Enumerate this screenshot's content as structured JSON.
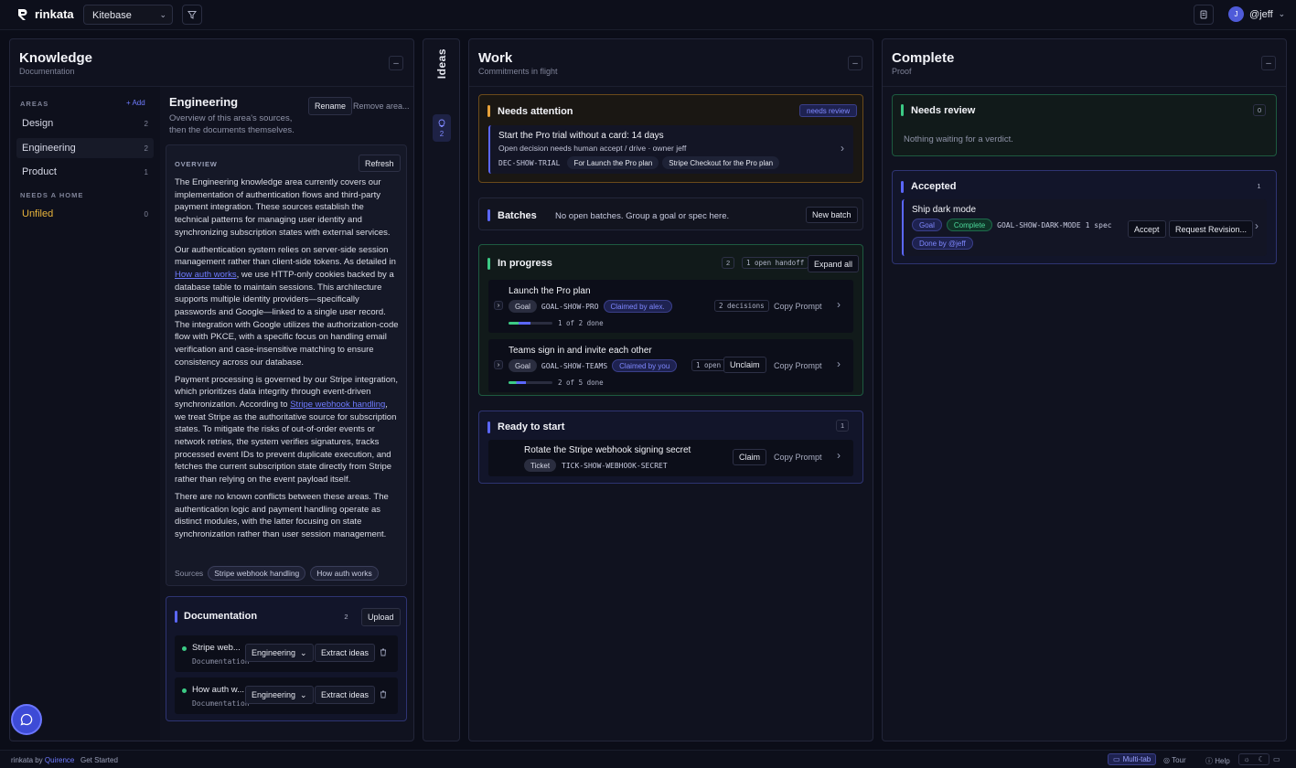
{
  "app": {
    "name": "rinkata",
    "workspace": "Kitebase",
    "user": "@jeff",
    "user_initial": "J"
  },
  "knowledge": {
    "title": "Knowledge",
    "subtitle": "Documentation",
    "areas_label": "AREAS",
    "add_label": "+ Add",
    "areas": [
      {
        "label": "Design",
        "count": "2"
      },
      {
        "label": "Engineering",
        "count": "2"
      },
      {
        "label": "Product",
        "count": "1"
      }
    ],
    "needs_home_label": "NEEDS A HOME",
    "unfiled": {
      "label": "Unfiled",
      "count": "0"
    },
    "detail": {
      "title": "Engineering",
      "subtitle": "Overview of this area's sources, then the documents themselves.",
      "rename_label": "Rename",
      "remove_label": "Remove area...",
      "overview_label": "OVERVIEW",
      "refresh_label": "Refresh",
      "p1": "The Engineering knowledge area currently covers our implementation of authentication flows and third-party payment integration. These sources establish the technical patterns for managing user identity and synchronizing subscription states with external services.",
      "p2a": "Our authentication system relies on server-side session management rather than client-side tokens. As detailed in ",
      "p2link": "How auth works",
      "p2b": ", we use HTTP-only cookies backed by a database table to maintain sessions. This architecture supports multiple identity providers—specifically passwords and Google—linked to a single user record. The integration with Google utilizes the authorization-code flow with PKCE, with a specific focus on handling email verification and case-insensitive matching to ensure consistency across our database.",
      "p3a": "Payment processing is governed by our Stripe integration, which prioritizes data integrity through event-driven synchronization. According to ",
      "p3link": "Stripe webhook handling",
      "p3b": ", we treat Stripe as the authoritative source for subscription states. To mitigate the risks of out-of-order events or network retries, the system verifies signatures, tracks processed event IDs to prevent duplicate execution, and fetches the current subscription state directly from Stripe rather than relying on the event payload itself.",
      "p4": "There are no known conflicts between these areas. The authentication logic and payment handling operate as distinct modules, with the latter focusing on state synchronization rather than user session management.",
      "sources_label": "Sources",
      "sources": [
        "Stripe webhook handling",
        "How auth works"
      ]
    },
    "documentation": {
      "title": "Documentation",
      "count": "2",
      "upload_label": "Upload",
      "docs": [
        {
          "name": "Stripe web...",
          "type": "Documentation",
          "area": "Engineering",
          "action": "Extract ideas"
        },
        {
          "name": "How auth w...",
          "type": "Documentation",
          "area": "Engineering",
          "action": "Extract ideas"
        }
      ]
    }
  },
  "ideas": {
    "label": "Ideas",
    "count": "2"
  },
  "work": {
    "title": "Work",
    "subtitle": "Commitments in flight",
    "attention": {
      "title": "Needs attention",
      "badge": "needs review",
      "item": {
        "title": "Start the Pro trial without a card: 14 days",
        "desc": "Open decision needs human accept / drive · owner jeff",
        "code": "DEC-SHOW-TRIAL",
        "tags": [
          "For Launch the Pro plan",
          "Stripe Checkout for the Pro plan"
        ]
      }
    },
    "batches": {
      "title": "Batches",
      "text": "No open batches. Group a goal or spec here.",
      "button": "New batch"
    },
    "in_progress": {
      "title": "In progress",
      "count": "2",
      "handoff": "1 open handoff",
      "expand_label": "Expand all",
      "items": [
        {
          "title": "Launch the Pro plan",
          "type": "Goal",
          "code": "GOAL-SHOW-PRO",
          "claim": "Claimed by alex.",
          "meta": "2 decisions",
          "progress_text": "1 of 2 done",
          "progress": 0.5,
          "prompt": "Copy Prompt"
        },
        {
          "title": "Teams sign in and invite each other",
          "type": "Goal",
          "code": "GOAL-SHOW-TEAMS",
          "claim": "Claimed by you",
          "meta": "1 open",
          "action": "Unclaim",
          "progress_text": "2 of 5 done",
          "progress": 0.4,
          "prompt": "Copy Prompt"
        }
      ]
    },
    "ready": {
      "title": "Ready to start",
      "count": "1",
      "item": {
        "title": "Rotate the Stripe webhook signing secret",
        "type": "Ticket",
        "code": "TICK-SHOW-WEBHOOK-SECRET",
        "action": "Claim",
        "prompt": "Copy Prompt"
      }
    }
  },
  "complete": {
    "title": "Complete",
    "subtitle": "Proof",
    "review": {
      "title": "Needs review",
      "count": "0",
      "empty": "Nothing waiting for a verdict."
    },
    "accepted": {
      "title": "Accepted",
      "count": "1",
      "item": {
        "title": "Ship dark mode",
        "type": "Goal",
        "status": "Complete",
        "code": "GOAL-SHOW-DARK-MODE",
        "meta": "1 spec",
        "done_by": "Done by @jeff",
        "accept_label": "Accept",
        "revision_label": "Request Revision..."
      }
    }
  },
  "footer": {
    "brand": "rinkata by",
    "brand_link": "Quirence",
    "get_started": "Get Started",
    "multitab": "Multi-tab",
    "tour": "Tour",
    "help": "Help"
  },
  "colors": {
    "accent": "#5b67ff",
    "attention": "#e8a23a",
    "progress": "#3ccb85",
    "ready": "#5b67ff"
  }
}
